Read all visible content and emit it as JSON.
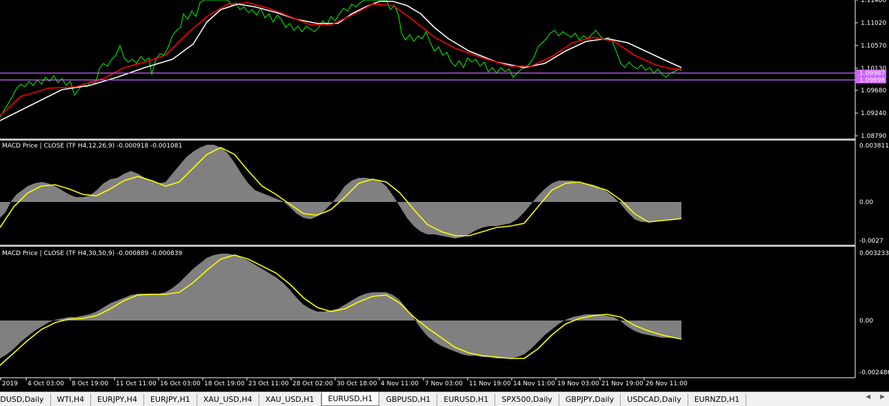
{
  "price_axis": {
    "labels": [
      "1.11480",
      "1.11020",
      "1.10570",
      "1.10130",
      "1.09680",
      "1.09240",
      "1.08790"
    ]
  },
  "price_boxes": [
    "1.09987",
    "1.09898"
  ],
  "macd1": {
    "label": "MACD Price | CLOSE  (TF H4,12,26,9) -0.000918 -0.001081",
    "axis_labels": [
      "0.003811",
      "0.00",
      "-0.0027"
    ]
  },
  "macd2": {
    "label": "MACD Price | CLOSE  (TF H4,30,50,9) -0.000889 -0.000839",
    "axis_labels": [
      "0.003233",
      "0.00",
      "-0.002486"
    ]
  },
  "time_axis": [
    "2019",
    "4 Oct 03:00",
    "8 Oct 19:00",
    "11 Oct 11:00",
    "16 Oct 03:00",
    "18 Oct 19:00",
    "23 Oct 11:00",
    "28 Oct 02:00",
    "30 Oct 18:00",
    "4 Nov 11:00",
    "7 Nov 03:00",
    "11 Nov 19:00",
    "14 Nov 11:00",
    "19 Nov 03:00",
    "21 Nov 19:00",
    "26 Nov 11:00"
  ],
  "tabs": [
    "JDUSD,Daily",
    "WTI,H4",
    "EURJPY,H4",
    "EURJPY,H1",
    "XAU_USD,H4",
    "XAU_USD,H1",
    "EURUSD,H1",
    "GBPUSD,H1",
    "EURUSD,H1",
    "SPX500,Daily",
    "GBPJPY,Daily",
    "USDCAD,Daily",
    "EURNZD,H1"
  ],
  "active_tab": 6,
  "colors": {
    "price": "#00ff00",
    "ma_fast": "#ff0000",
    "ma_slow": "#ffffff",
    "hist": "#808080",
    "signal": "#ffff00",
    "hline": "#cc66ff"
  }
}
